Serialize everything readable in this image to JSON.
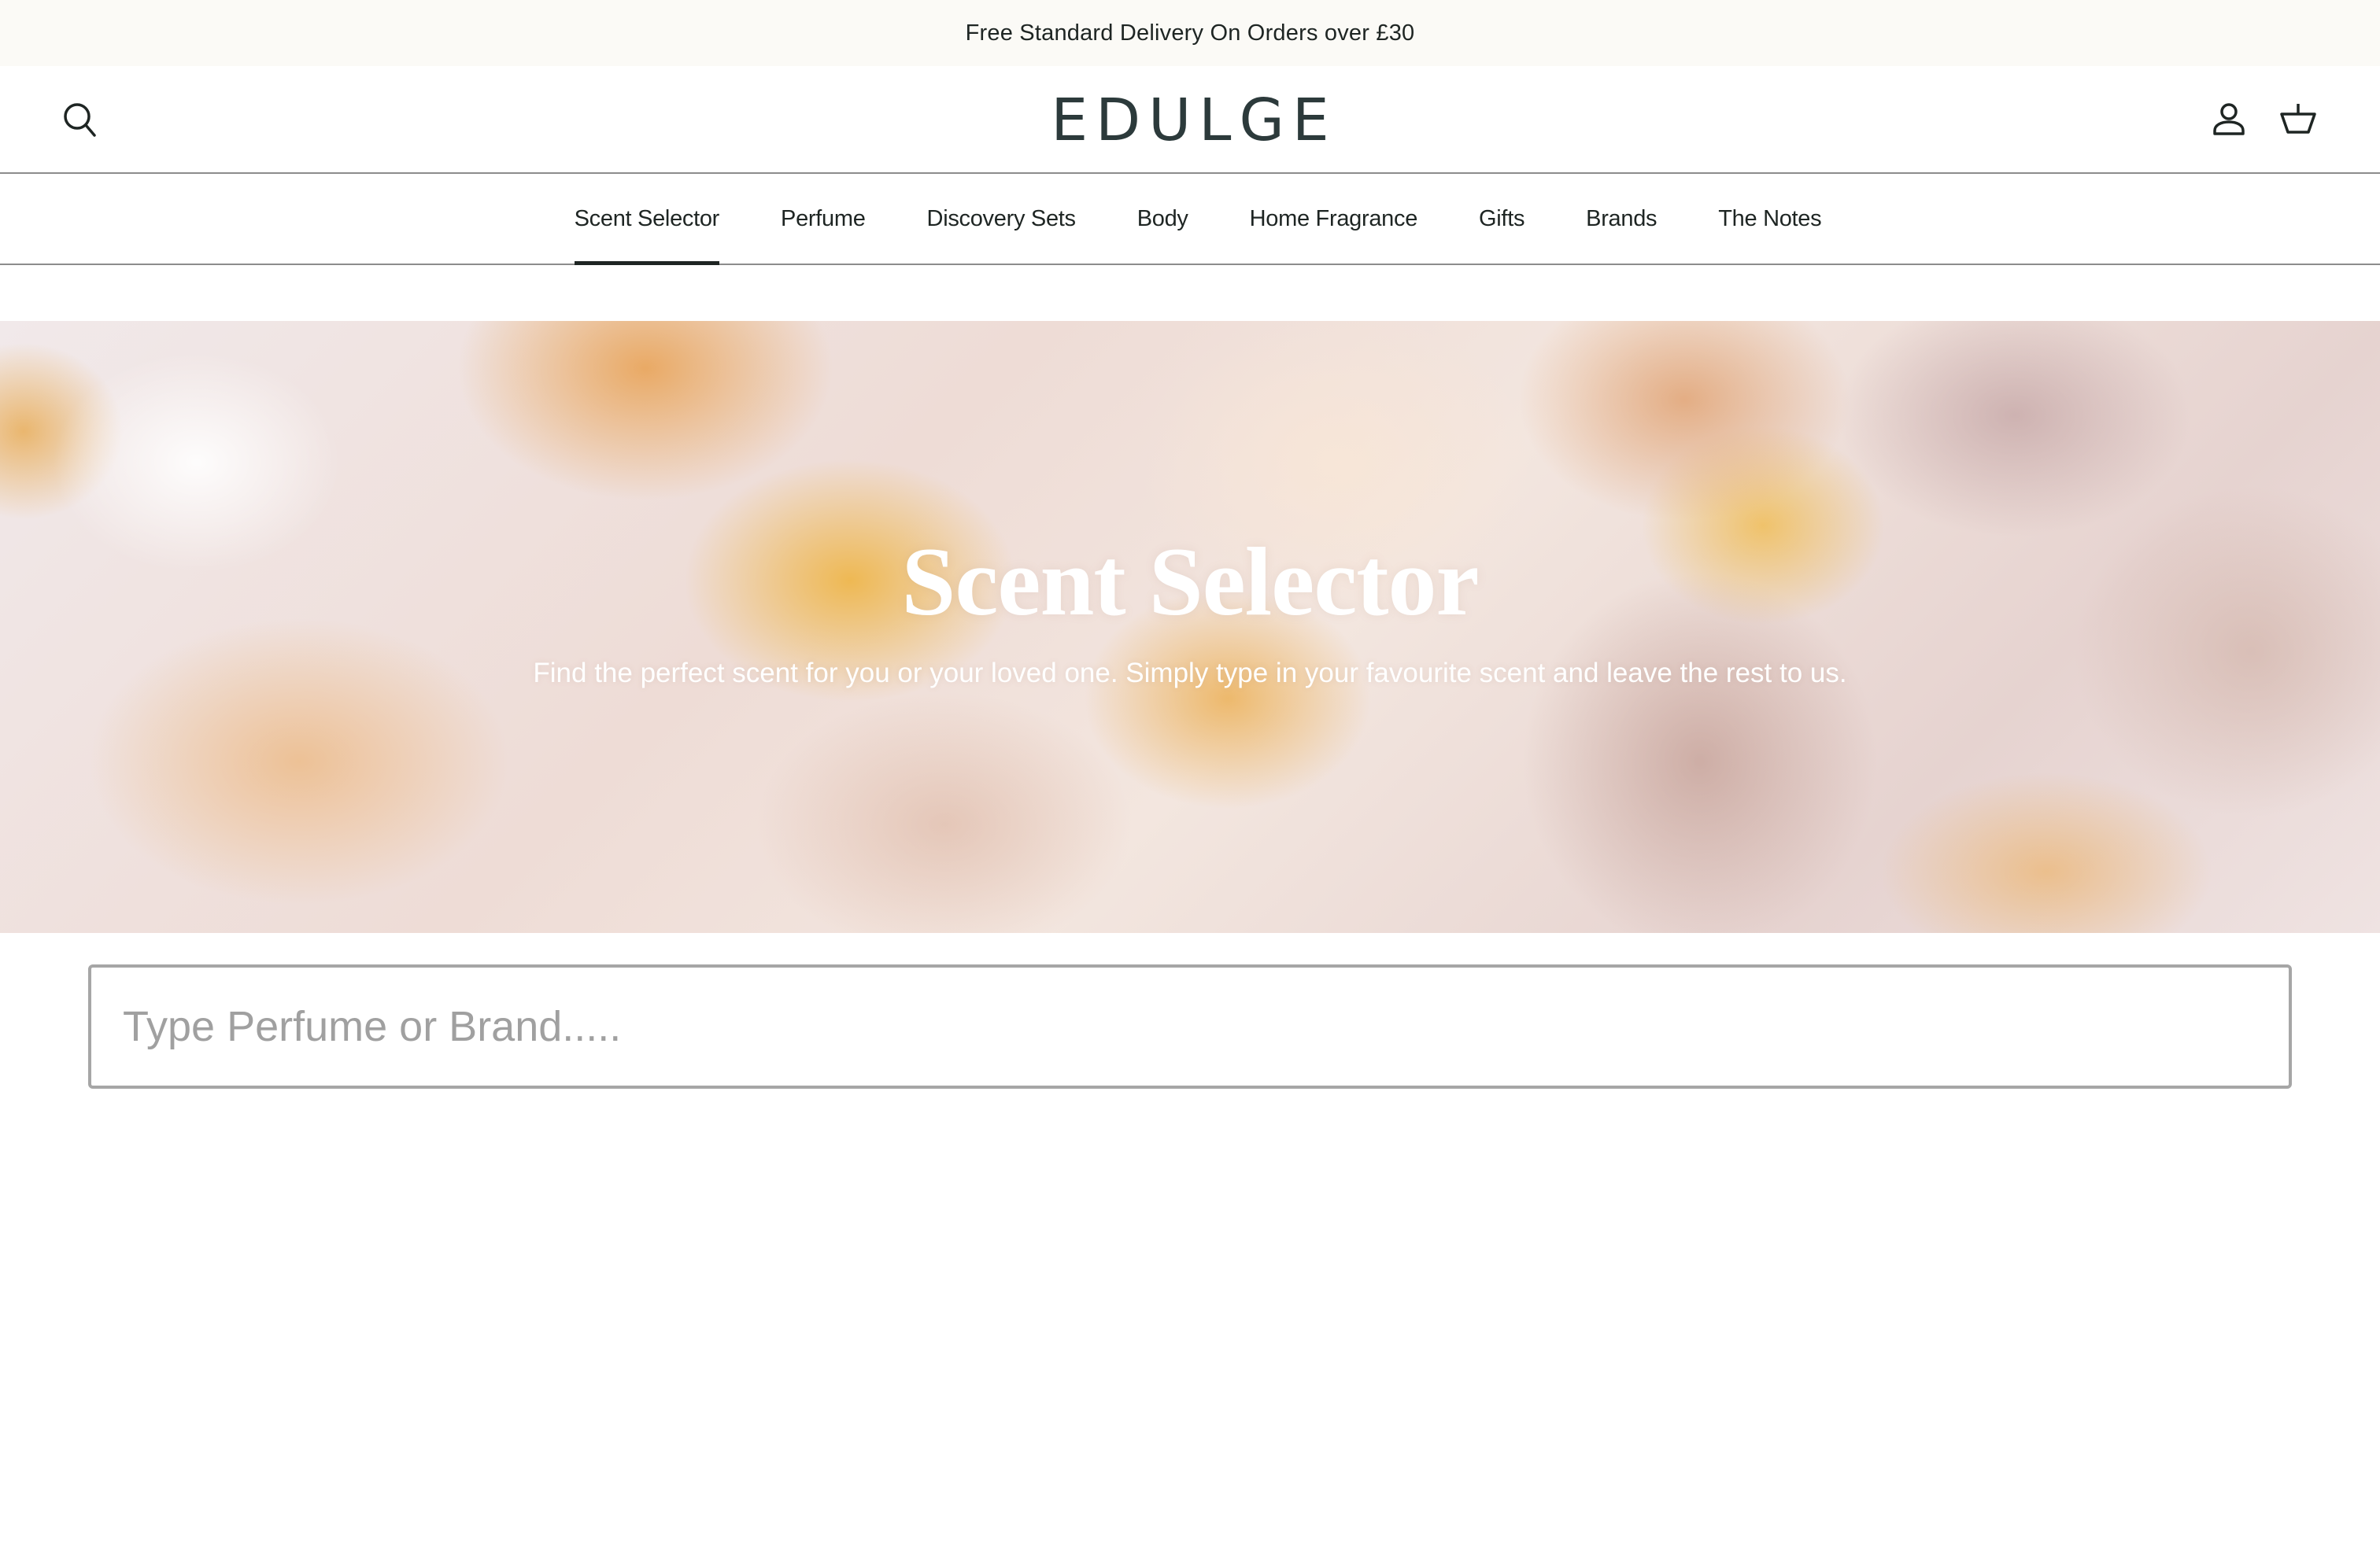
{
  "announcement": {
    "text": "Free Standard Delivery On Orders over £30"
  },
  "header": {
    "logo": "EDULGE",
    "icons": {
      "search": "search-icon",
      "account": "account-icon",
      "basket": "basket-icon"
    }
  },
  "nav": {
    "items": [
      {
        "label": "Scent Selector",
        "active": true
      },
      {
        "label": "Perfume",
        "active": false
      },
      {
        "label": "Discovery Sets",
        "active": false
      },
      {
        "label": "Body",
        "active": false
      },
      {
        "label": "Home Fragrance",
        "active": false
      },
      {
        "label": "Gifts",
        "active": false
      },
      {
        "label": "Brands",
        "active": false
      },
      {
        "label": "The Notes",
        "active": false
      }
    ]
  },
  "hero": {
    "title": "Scent Selector",
    "subtitle": "Find the perfect scent for you or your loved one. Simply type in your favourite scent and leave the rest to us.",
    "background": "rose petals image"
  },
  "search": {
    "value": "",
    "placeholder": "Type Perfume or Brand....."
  },
  "colors": {
    "text": "#1e2523",
    "logo": "#2c3a3b",
    "announcement_bg": "#fbfaf6",
    "border": "#8c8c8c",
    "input_border": "#a6a6a6",
    "placeholder": "#a0a0a0"
  }
}
